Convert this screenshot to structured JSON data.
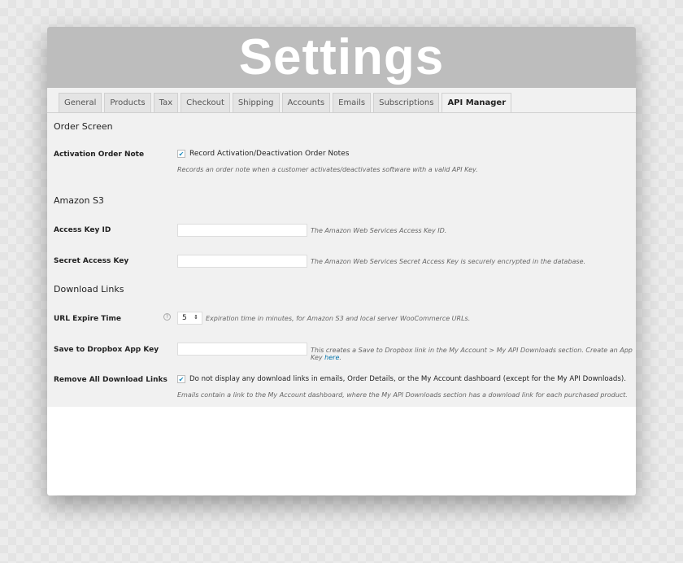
{
  "header": {
    "title": "Settings"
  },
  "tabs": [
    {
      "label": "General"
    },
    {
      "label": "Products"
    },
    {
      "label": "Tax"
    },
    {
      "label": "Checkout"
    },
    {
      "label": "Shipping"
    },
    {
      "label": "Accounts"
    },
    {
      "label": "Emails"
    },
    {
      "label": "Subscriptions"
    },
    {
      "label": "API Manager",
      "active": true
    }
  ],
  "order_screen": {
    "heading": "Order Screen",
    "activation_label": "Activation Order Note",
    "activation_checkbox": "Record Activation/Deactivation Order Notes",
    "activation_checked": true,
    "activation_desc": "Records an order note when a customer activates/deactivates software with a valid API Key."
  },
  "amazon": {
    "heading": "Amazon S3",
    "access_label": "Access Key ID",
    "access_value": "",
    "access_desc": "The Amazon Web Services Access Key ID.",
    "secret_label": "Secret Access Key",
    "secret_value": "",
    "secret_desc": "The Amazon Web Services Secret Access Key is securely encrypted in the database."
  },
  "downloads": {
    "heading": "Download Links",
    "expire_label": "URL Expire Time",
    "expire_value": "5",
    "expire_desc": "Expiration time in minutes, for Amazon S3 and local server WooCommerce URLs.",
    "dropbox_label": "Save to Dropbox App Key",
    "dropbox_value": "",
    "dropbox_desc": "This creates a Save to Dropbox link in the My Account > My API Downloads section. Create an App Key ",
    "dropbox_link": "here",
    "dropbox_end": ".",
    "remove_label": "Remove All Download Links",
    "remove_checkbox": "Do not display any download links in emails, Order Details, or the My Account dashboard (except for the My API Downloads).",
    "remove_checked": true,
    "remove_desc": "Emails contain a link to the My Account dashboard, where the My API Downloads section has a download link for each purchased product."
  }
}
